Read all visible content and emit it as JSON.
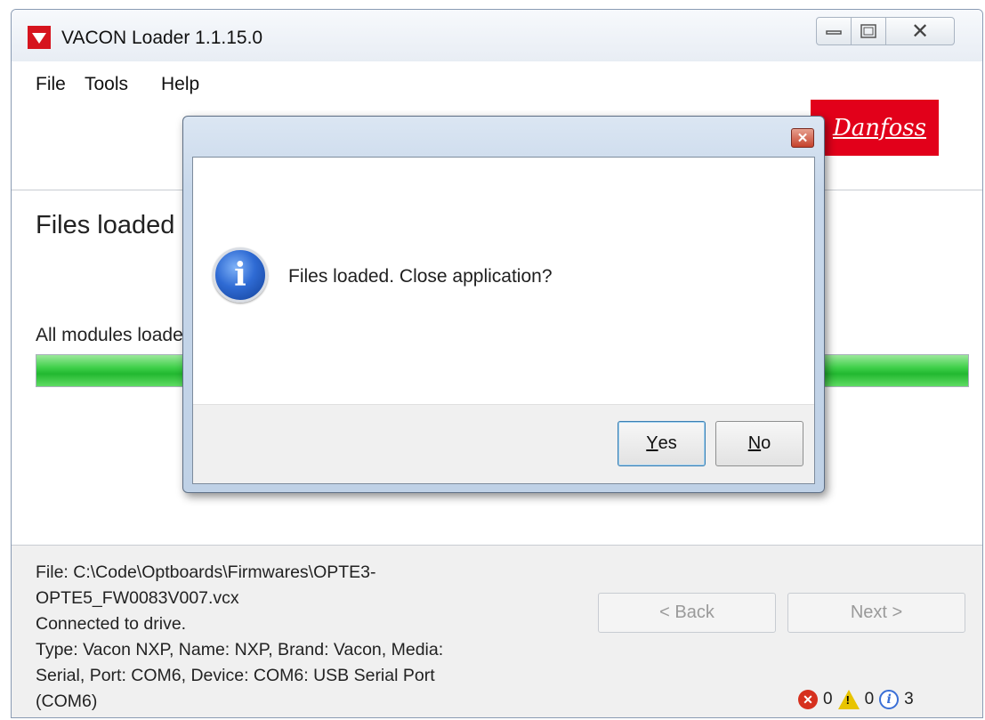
{
  "window": {
    "title": "VACON Loader 1.1.15.0",
    "icon": "vacon-logo-icon",
    "controls": [
      "minimize-icon",
      "maximize-icon",
      "close-icon"
    ]
  },
  "menu": {
    "items": [
      {
        "label": "File"
      },
      {
        "label": "Tools"
      },
      {
        "label": "Help"
      }
    ]
  },
  "brand": {
    "logo_text": "Danfoss",
    "color": "#e2001a"
  },
  "main": {
    "heading": "Files loaded",
    "status_message": "All modules loaded",
    "progress_fraction": 1.0,
    "progress_color": "#2ec23a"
  },
  "footer": {
    "info_text": "File: C:\\Code\\Optboards\\Firmwares\\OPTE3-\nOPTE5_FW0083V007.vcx\nConnected to drive.\nType: Vacon NXP, Name: NXP, Brand: Vacon, Media:\nSerial, Port: COM6, Device: COM6: USB Serial Port\n(COM6)",
    "back_label": "< Back",
    "next_label": "Next >",
    "counters": {
      "errors": "0",
      "warnings": "0",
      "info": "3"
    }
  },
  "dialog": {
    "message": "Files loaded. Close application?",
    "icon": "information-icon",
    "yes_label": "es",
    "yes_mnemonic": "Y",
    "no_label": "o",
    "no_mnemonic": "N"
  }
}
